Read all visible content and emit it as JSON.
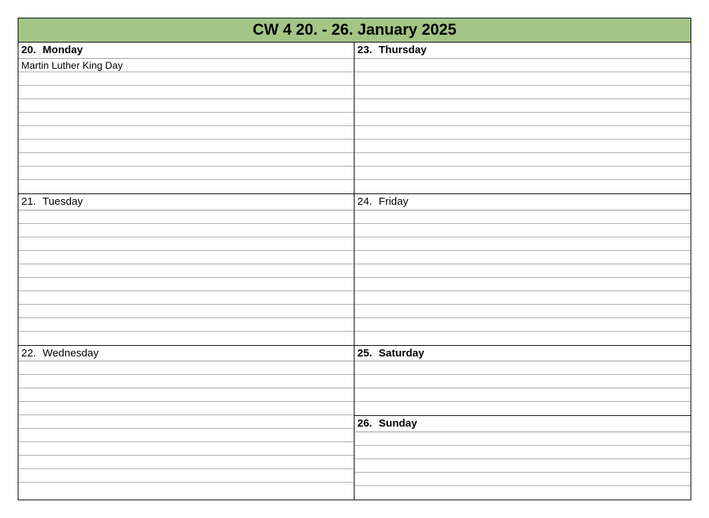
{
  "title": "CW 4    20. - 26. January 2025",
  "colors": {
    "header_bg": "#a3c585"
  },
  "left": [
    {
      "num": "20.",
      "name": "Monday",
      "bold": true,
      "lines": 10,
      "entries": [
        "Martin Luther King Day"
      ]
    },
    {
      "num": "21.",
      "name": "Tuesday",
      "bold": false,
      "lines": 10,
      "entries": []
    },
    {
      "num": "22.",
      "name": "Wednesday",
      "bold": false,
      "lines": 10,
      "entries": []
    }
  ],
  "right": [
    {
      "num": "23.",
      "name": "Thursday",
      "bold": true,
      "lines": 10,
      "entries": []
    },
    {
      "num": "24.",
      "name": "Friday",
      "bold": false,
      "lines": 10,
      "entries": []
    },
    {
      "num": "25.",
      "name": "Saturday",
      "bold": true,
      "lines": 4,
      "entries": []
    },
    {
      "num": "26.",
      "name": "Sunday",
      "bold": true,
      "lines": 5,
      "entries": []
    }
  ]
}
